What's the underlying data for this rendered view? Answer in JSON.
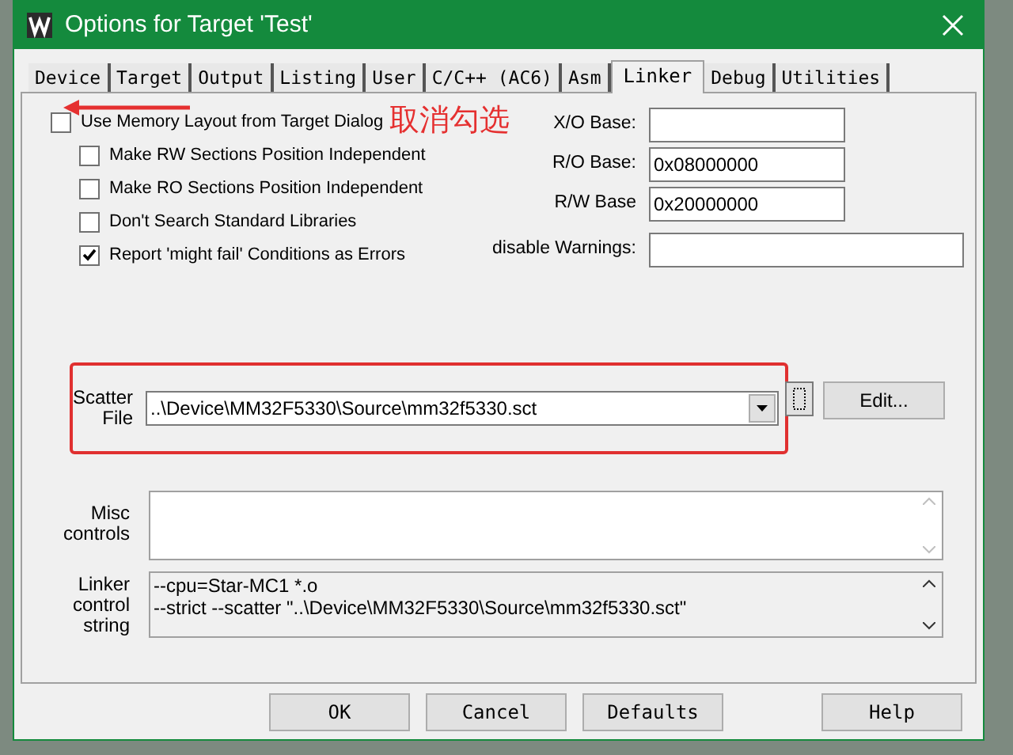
{
  "window": {
    "title": "Options for Target 'Test'"
  },
  "tabs": [
    {
      "label": "Device",
      "selected": false
    },
    {
      "label": "Target",
      "selected": false
    },
    {
      "label": "Output",
      "selected": false
    },
    {
      "label": "Listing",
      "selected": false
    },
    {
      "label": "User",
      "selected": false
    },
    {
      "label": "C/C++ (AC6)",
      "selected": false
    },
    {
      "label": "Asm",
      "selected": false
    },
    {
      "label": "Linker",
      "selected": true
    },
    {
      "label": "Debug",
      "selected": false
    },
    {
      "label": "Utilities",
      "selected": false
    }
  ],
  "memory_layout_option": {
    "label": "Use Memory Layout from Target Dialog",
    "checked": false
  },
  "options": [
    {
      "label": "Make RW Sections Position Independent",
      "checked": false
    },
    {
      "label": "Make RO Sections Position Independent",
      "checked": false
    },
    {
      "label": "Don't Search Standard Libraries",
      "checked": false
    },
    {
      "label": "Report 'might fail' Conditions as Errors",
      "checked": true
    }
  ],
  "fields": [
    {
      "label": "X/O Base:"
    },
    {
      "label": "R/O Base:",
      "value": "0x08000000"
    },
    {
      "label": "R/W Base",
      "value": "0x20000000"
    },
    {
      "label": "disable Warnings:"
    }
  ],
  "scatter_file": {
    "label_lines": [
      "Scatter",
      "File"
    ],
    "value": "..\\Device\\MM32F5330\\Source\\mm32f5330.sct",
    "edit_button": "Edit..."
  },
  "misc_controls": {
    "label_lines": [
      "Misc",
      "controls"
    ]
  },
  "linker_control_string": {
    "label_lines": [
      "Linker",
      "control",
      "string"
    ],
    "lines": [
      "--cpu=Star-MC1 *.o",
      "--strict --scatter \"..\\Device\\MM32F5330\\Source\\mm32f5330.sct\""
    ]
  },
  "buttons": [
    "OK",
    "Cancel",
    "Defaults",
    "Help"
  ],
  "annotation": {
    "text": "取消勾选"
  }
}
